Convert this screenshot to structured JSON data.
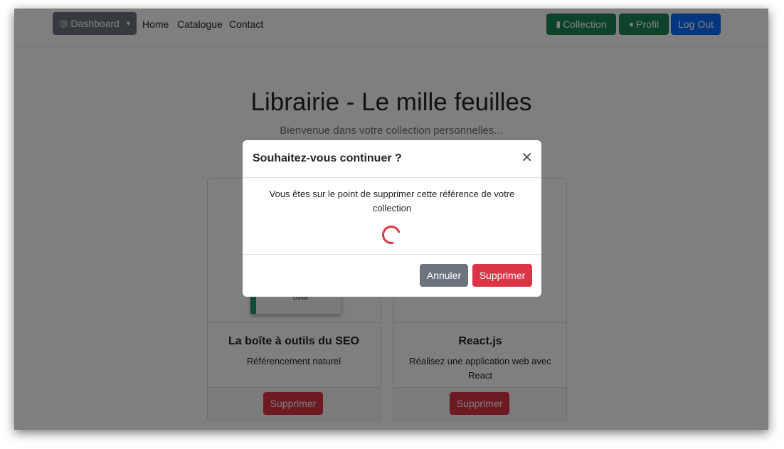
{
  "navbar": {
    "dashboard_label": "Dashboard",
    "links": [
      "Home",
      "Catalogue",
      "Contact"
    ],
    "collection_label": "Collection",
    "profil_label": "Profil",
    "logout_label": "Log Out"
  },
  "hero": {
    "title": "Librairie - Le mille feuilles",
    "subtitle": "Bienvenue dans votre collection personnelles..."
  },
  "cards": [
    {
      "title": "La boîte à outils du SEO",
      "text": "Référencement naturel",
      "button": "Supprimer",
      "publisher": "Dunod"
    },
    {
      "title": "React.js",
      "text": "Réalisez une application web avec React",
      "button": "Supprimer"
    }
  ],
  "modal": {
    "title": "Souhaitez-vous continuer ?",
    "message": "Vous êtes sur le point de supprimer cette référence de votre collection",
    "cancel_label": "Annuler",
    "confirm_label": "Supprimer"
  },
  "icons": {
    "dashboard": "dashboard-icon",
    "collection": "book-icon",
    "profil": "user-icon",
    "close": "close-icon"
  },
  "colors": {
    "success": "#198754",
    "primary": "#0d6efd",
    "danger": "#dc3545",
    "secondary": "#6c757d"
  }
}
